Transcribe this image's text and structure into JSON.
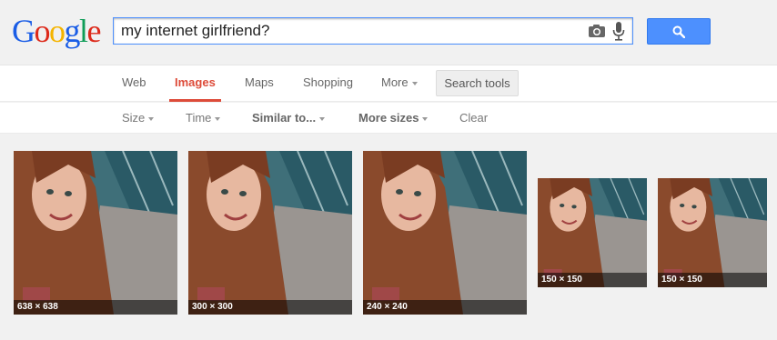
{
  "logo": {
    "letters": [
      "G",
      "o",
      "o",
      "g",
      "l",
      "e"
    ],
    "colors": [
      "#1a5de6",
      "#dd2a1b",
      "#f4b400",
      "#1a5de6",
      "#109d58",
      "#dd2a1b"
    ]
  },
  "search": {
    "query": "my internet girlfriend?",
    "camera_icon": "camera-icon",
    "mic_icon": "microphone-icon",
    "button_icon": "magnifier-icon"
  },
  "nav": {
    "tabs": [
      {
        "label": "Web",
        "active": false
      },
      {
        "label": "Images",
        "active": true
      },
      {
        "label": "Maps",
        "active": false
      },
      {
        "label": "Shopping",
        "active": false
      },
      {
        "label": "More",
        "active": false
      }
    ],
    "search_tools": "Search tools"
  },
  "tools": {
    "items": [
      {
        "label": "Size"
      },
      {
        "label": "Time"
      },
      {
        "label": "Similar to..."
      },
      {
        "label": "More sizes"
      },
      {
        "label": "Clear"
      }
    ]
  },
  "results": [
    {
      "size": "638 × 638"
    },
    {
      "size": "300 × 300"
    },
    {
      "size": "240 × 240"
    },
    {
      "size": "150 × 150"
    },
    {
      "size": "150 × 150"
    }
  ],
  "colors": {
    "accent_red": "#dd4b39",
    "search_blue": "#4d90fe"
  }
}
